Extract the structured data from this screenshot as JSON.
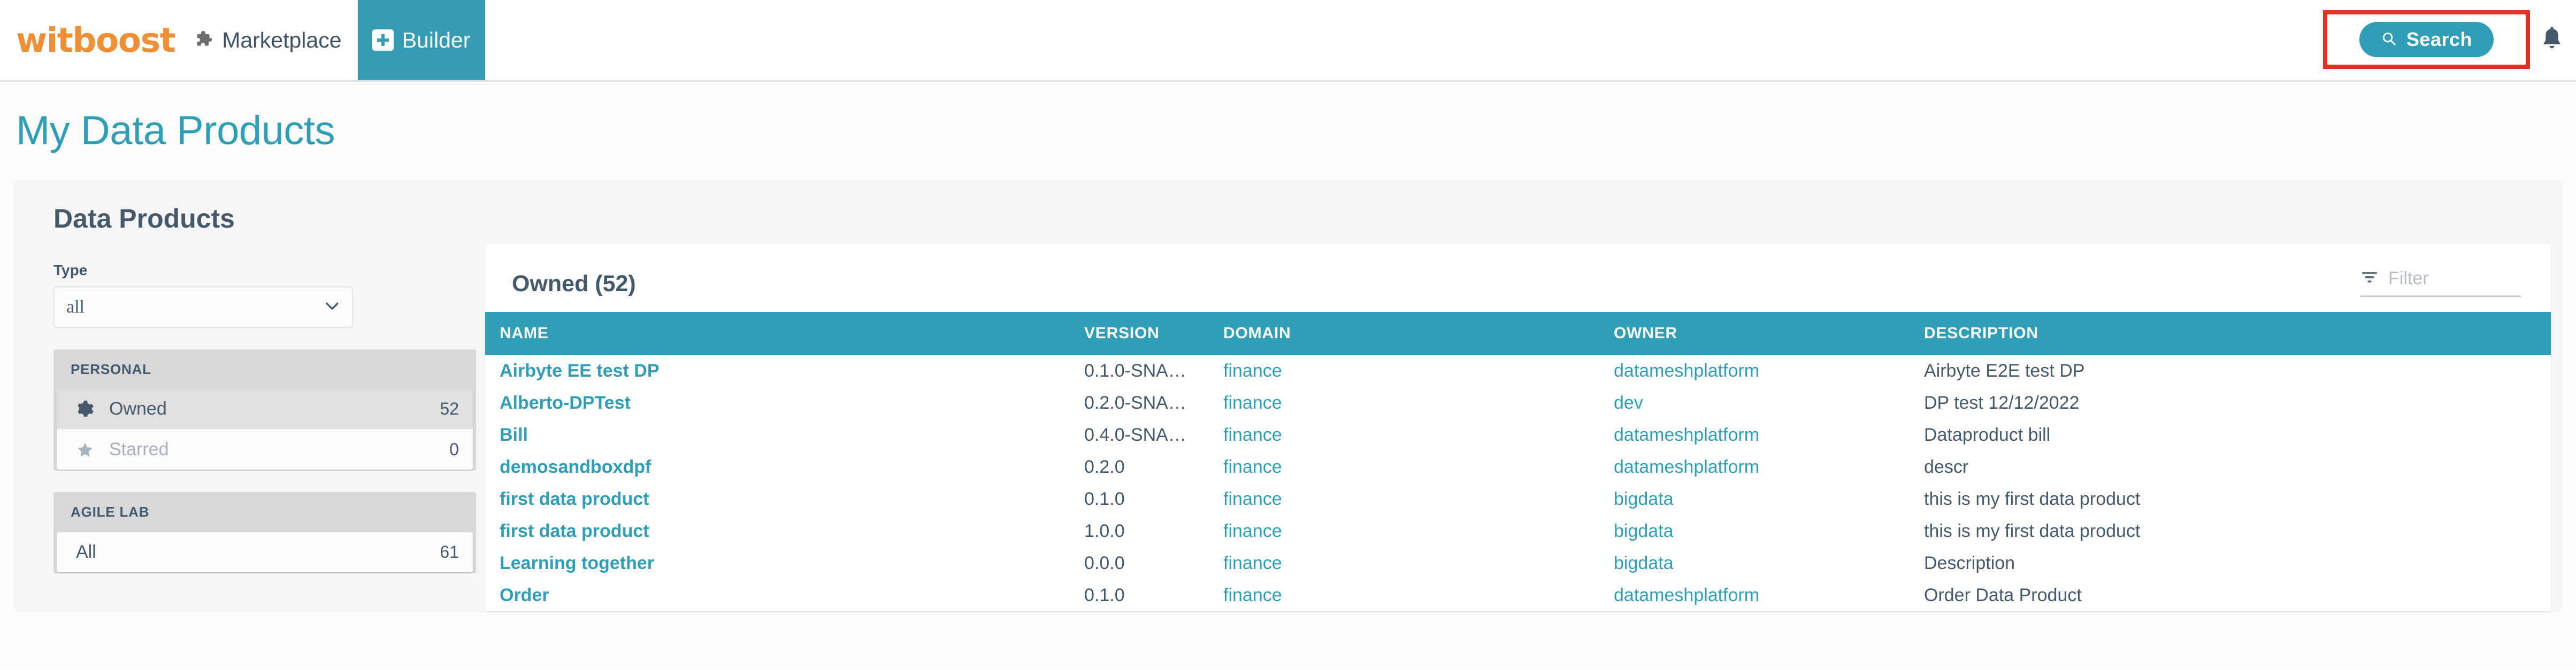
{
  "topbar": {
    "logo_text": "witboost",
    "marketplace_label": "Marketplace",
    "builder_label": "Builder",
    "search_label": "Search",
    "icons": {
      "marketplace": "puzzle-piece-icon",
      "builder_add": "plus-square-icon",
      "search": "search-icon",
      "notifications": "bell-icon"
    },
    "highlight_color": "#e03127",
    "accent_color": "#2f9fb8",
    "brand_color": "#ef8f35"
  },
  "page": {
    "title": "My Data Products",
    "card_heading": "Data Products"
  },
  "filters": {
    "type_label": "Type",
    "type_value": "all",
    "type_options": [
      "all"
    ],
    "groups": [
      {
        "title": "PERSONAL",
        "items": [
          {
            "label": "Owned",
            "count": "52",
            "icon": "gear-icon",
            "active": true
          },
          {
            "label": "Starred",
            "count": "0",
            "icon": "star-icon",
            "active": false
          }
        ]
      },
      {
        "title": "AGILE LAB",
        "items": [
          {
            "label": "All",
            "count": "61",
            "icon": "",
            "active": false
          }
        ]
      }
    ]
  },
  "table_panel": {
    "title": "Owned (52)",
    "filter_placeholder": "Filter",
    "filter_icon": "filter-icon",
    "columns": [
      "NAME",
      "VERSION",
      "DOMAIN",
      "OWNER",
      "DESCRIPTION"
    ],
    "rows": [
      {
        "name": "Airbyte EE test DP",
        "version": "0.1.0-SNA…",
        "domain": "finance",
        "owner": "datameshplatform",
        "description": "Airbyte E2E test DP"
      },
      {
        "name": "Alberto-DPTest",
        "version": "0.2.0-SNA…",
        "domain": "finance",
        "owner": "dev",
        "description": "DP test 12/12/2022"
      },
      {
        "name": "Bill",
        "version": "0.4.0-SNA…",
        "domain": "finance",
        "owner": "datameshplatform",
        "description": "Dataproduct bill"
      },
      {
        "name": "demosandboxdpf",
        "version": "0.2.0",
        "domain": "finance",
        "owner": "datameshplatform",
        "description": "descr"
      },
      {
        "name": "first data product",
        "version": "0.1.0",
        "domain": "finance",
        "owner": "bigdata",
        "description": "this is my first data product"
      },
      {
        "name": "first data product",
        "version": "1.0.0",
        "domain": "finance",
        "owner": "bigdata",
        "description": "this is my first data product"
      },
      {
        "name": "Learning together",
        "version": "0.0.0",
        "domain": "finance",
        "owner": "bigdata",
        "description": "Description"
      },
      {
        "name": "Order",
        "version": "0.1.0",
        "domain": "finance",
        "owner": "datameshplatform",
        "description": "Order Data Product"
      }
    ]
  }
}
